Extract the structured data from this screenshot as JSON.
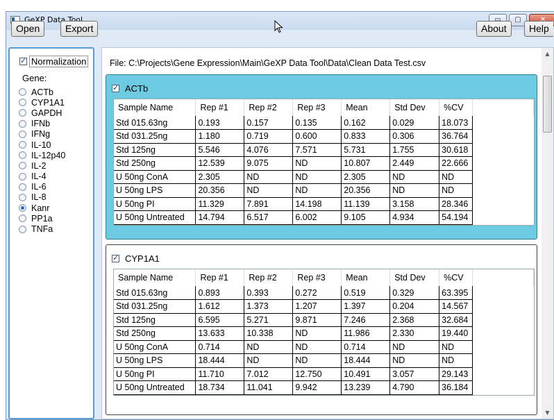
{
  "window": {
    "title": "GeXP Data Tool",
    "controls": {
      "minimize": "▭",
      "maximize": "▢",
      "close": "✕"
    }
  },
  "toolbar": {
    "open_label": "Open",
    "export_label": "Export",
    "about_label": "About",
    "help_label": "Help"
  },
  "sidebar": {
    "normalization_label": "Normalization",
    "normalization_checked": true,
    "gene_label": "Gene:",
    "genes": [
      "ACTb",
      "CYP1A1",
      "GAPDH",
      "IFNb",
      "IFNg",
      "IL-10",
      "IL-12p40",
      "IL-2",
      "IL-4",
      "IL-6",
      "IL-8",
      "Kanr",
      "PP1a",
      "TNFa"
    ],
    "selected_gene": "Kanr"
  },
  "main": {
    "file_path": "File: C:\\Projects\\Gene Expression\\Main\\GeXP Data Tool\\Data\\Clean Data Test.csv",
    "columns": [
      "Sample Name",
      "Rep #1",
      "Rep #2",
      "Rep #3",
      "Mean",
      "Std Dev",
      "%CV"
    ],
    "panels": [
      {
        "name": "ACTb",
        "checked": true,
        "selected": true,
        "rows": [
          [
            "Std 015.63ng",
            "0.193",
            "0.157",
            "0.135",
            "0.162",
            "0.029",
            "18.073"
          ],
          [
            "Std 031.25ng",
            "1.180",
            "0.719",
            "0.600",
            "0.833",
            "0.306",
            "36.764"
          ],
          [
            "Std 125ng",
            "5.546",
            "4.076",
            "7.571",
            "5.731",
            "1.755",
            "30.618"
          ],
          [
            "Std 250ng",
            "12.539",
            "9.075",
            "ND",
            "10.807",
            "2.449",
            "22.666"
          ],
          [
            "U 50ng ConA",
            "2.305",
            "ND",
            "ND",
            "2.305",
            "ND",
            "ND"
          ],
          [
            "U 50ng LPS",
            "20.356",
            "ND",
            "ND",
            "20.356",
            "ND",
            "ND"
          ],
          [
            "U 50ng PI",
            "11.329",
            "7.891",
            "14.198",
            "11.139",
            "3.158",
            "28.346"
          ],
          [
            "U 50ng Untreated",
            "14.794",
            "6.517",
            "6.002",
            "9.105",
            "4.934",
            "54.194"
          ]
        ]
      },
      {
        "name": "CYP1A1",
        "checked": true,
        "selected": false,
        "rows": [
          [
            "Std 015.63ng",
            "0.893",
            "0.393",
            "0.272",
            "0.519",
            "0.329",
            "63.395"
          ],
          [
            "Std 031.25ng",
            "1.612",
            "1.373",
            "1.207",
            "1.397",
            "0.204",
            "14.567"
          ],
          [
            "Std 125ng",
            "6.595",
            "5.271",
            "9.871",
            "7.246",
            "2.368",
            "32.684"
          ],
          [
            "Std 250ng",
            "13.633",
            "10.338",
            "ND",
            "11.986",
            "2.330",
            "19.440"
          ],
          [
            "U 50ng ConA",
            "0.714",
            "ND",
            "ND",
            "0.714",
            "ND",
            "ND"
          ],
          [
            "U 50ng LPS",
            "18.444",
            "ND",
            "ND",
            "18.444",
            "ND",
            "ND"
          ],
          [
            "U 50ng PI",
            "11.710",
            "7.012",
            "12.750",
            "10.491",
            "3.057",
            "29.143"
          ],
          [
            "U 50ng Untreated",
            "18.734",
            "11.041",
            "9.942",
            "13.239",
            "4.790",
            "36.184"
          ]
        ]
      }
    ]
  },
  "colors": {
    "selected_panel": "#6ccbe0",
    "accent": "#5b9bd5"
  }
}
